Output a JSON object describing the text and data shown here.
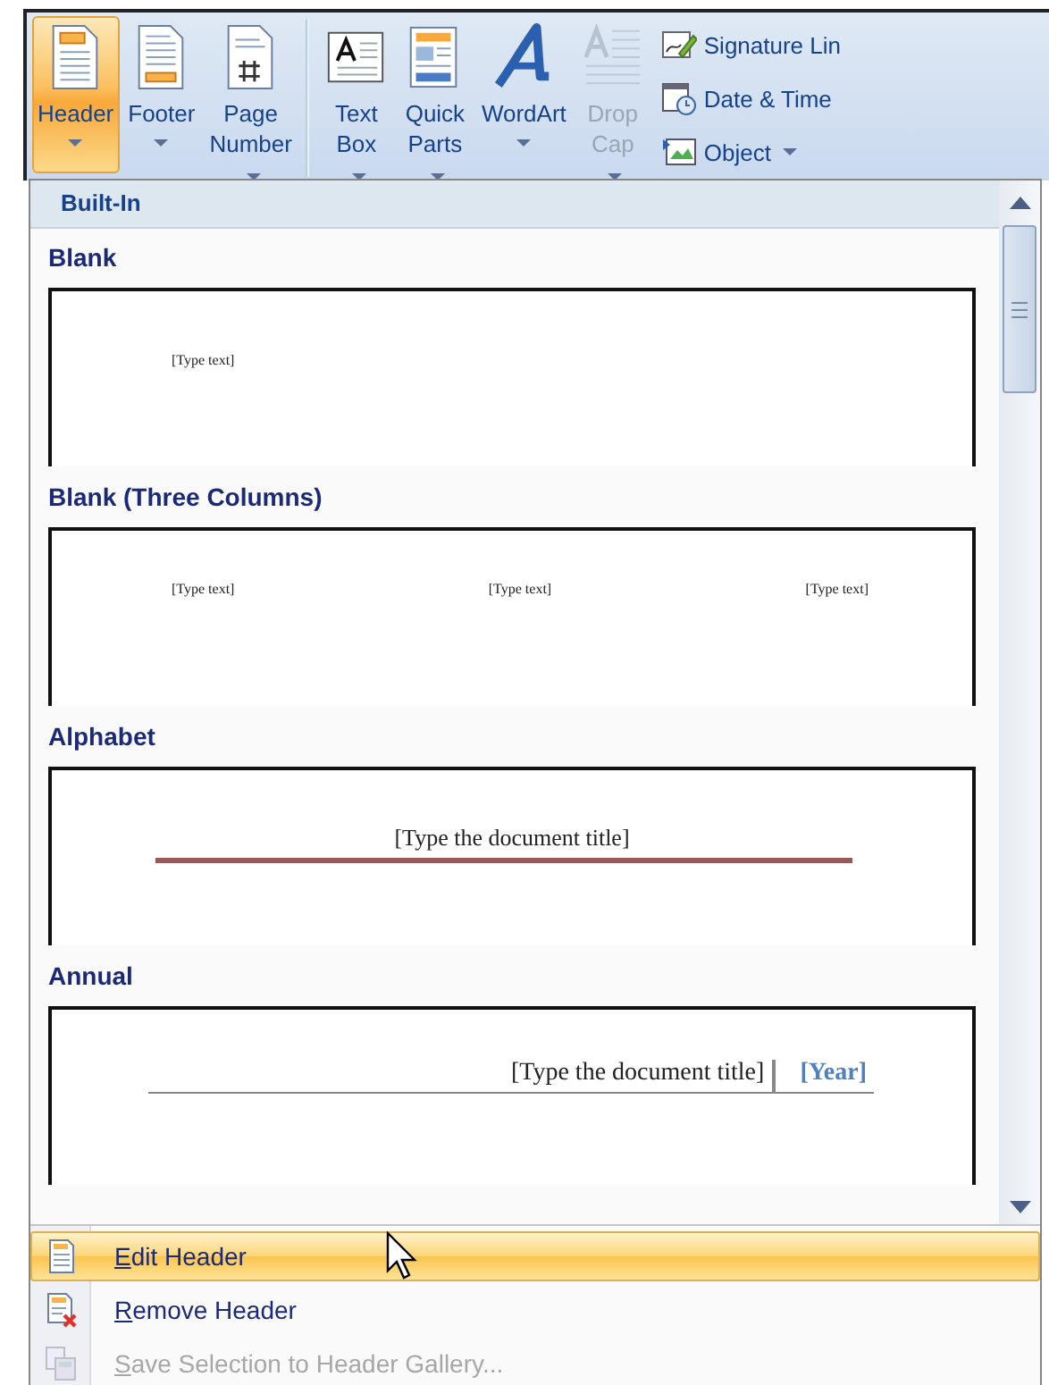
{
  "ribbon": {
    "large_buttons": [
      {
        "label": "Header",
        "selected": true,
        "disabled": false
      },
      {
        "label": "Footer",
        "selected": false,
        "disabled": false
      },
      {
        "label": "Page Number",
        "selected": false,
        "disabled": false
      },
      {
        "label": "Text Box",
        "selected": false,
        "disabled": false
      },
      {
        "label": "Quick Parts",
        "selected": false,
        "disabled": false
      },
      {
        "label": "WordArt",
        "selected": false,
        "disabled": false
      },
      {
        "label": "Drop Cap",
        "selected": false,
        "disabled": true
      }
    ],
    "small_buttons": [
      {
        "label": "Signature Lin"
      },
      {
        "label": "Date & Time"
      },
      {
        "label": "Object"
      }
    ]
  },
  "gallery": {
    "section": "Built-In",
    "items": [
      {
        "name": "Blank",
        "kind": "blank",
        "texts": [
          "[Type text]"
        ]
      },
      {
        "name": "Blank (Three Columns)",
        "kind": "three_columns",
        "texts": [
          "[Type text]",
          "[Type text]",
          "[Type text]"
        ]
      },
      {
        "name": "Alphabet",
        "kind": "alphabet",
        "texts": [
          "[Type the document title]"
        ]
      },
      {
        "name": "Annual",
        "kind": "annual",
        "texts": [
          "[Type the document title]",
          "[Year]"
        ]
      }
    ]
  },
  "menu": [
    {
      "label": "Edit Header",
      "selected": true,
      "disabled": false
    },
    {
      "label": "Remove Header",
      "selected": false,
      "disabled": false
    },
    {
      "label": "Save Selection to Header Gallery...",
      "selected": false,
      "disabled": true
    }
  ]
}
